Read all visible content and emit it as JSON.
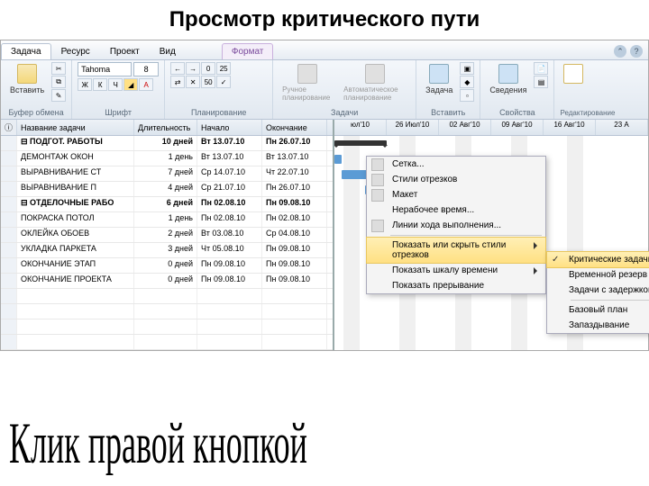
{
  "slide_title": "Просмотр критического пути",
  "caption": "Клик правой кнопкой",
  "tabs": {
    "task": "Задача",
    "resource": "Ресурс",
    "project": "Проект",
    "view": "Вид",
    "format": "Формат"
  },
  "ribbon": {
    "clipboard": {
      "label": "Буфер обмена",
      "paste": "Вставить"
    },
    "font": {
      "label": "Шрифт",
      "family": "Tahoma",
      "size": "8",
      "bold": "Ж",
      "italic": "К",
      "underline": "Ч"
    },
    "schedule": {
      "label": "Планирование"
    },
    "tasks": {
      "label": "Задачи",
      "manual": "Ручное планирование",
      "auto": "Автоматическое планирование"
    },
    "insert": {
      "label": "Вставить",
      "task": "Задача"
    },
    "props": {
      "label": "Свойства",
      "info": "Сведения"
    },
    "edit": {
      "label": "Редактирование"
    }
  },
  "grid": {
    "headers": {
      "name": "Название задачи",
      "dur": "Длительность",
      "start": "Начало",
      "end": "Окончание"
    },
    "rows": [
      {
        "id": "1",
        "name": "⊟ ПОДГОТ. РАБОТЫ",
        "dur": "10 дней",
        "s": "Вт 13.07.10",
        "e": "Пн 26.07.10",
        "bold": true
      },
      {
        "id": "2",
        "name": "ДЕМОНТАЖ ОКОН",
        "dur": "1 день",
        "s": "Вт 13.07.10",
        "e": "Вт 13.07.10"
      },
      {
        "id": "3",
        "name": "ВЫРАВНИВАНИЕ СТ",
        "dur": "7 дней",
        "s": "Ср 14.07.10",
        "e": "Чт 22.07.10"
      },
      {
        "id": "4",
        "name": "ВЫРАВНИВАНИЕ П",
        "dur": "4 дней",
        "s": "Ср 21.07.10",
        "e": "Пн 26.07.10"
      },
      {
        "id": "5",
        "name": "⊟ ОТДЕЛОЧНЫЕ РАБО",
        "dur": "6 дней",
        "s": "Пн 02.08.10",
        "e": "Пн 09.08.10",
        "bold": true
      },
      {
        "id": "6",
        "name": "ПОКРАСКА ПОТОЛ",
        "dur": "1 день",
        "s": "Пн 02.08.10",
        "e": "Пн 02.08.10"
      },
      {
        "id": "7",
        "name": "ОКЛЕЙКА ОБОЕВ",
        "dur": "2 дней",
        "s": "Вт 03.08.10",
        "e": "Ср 04.08.10"
      },
      {
        "id": "8",
        "name": "УКЛАДКА ПАРКЕТА",
        "dur": "3 дней",
        "s": "Чт 05.08.10",
        "e": "Пн 09.08.10"
      },
      {
        "id": "9",
        "name": "ОКОНЧАНИЕ ЭТАП",
        "dur": "0 дней",
        "s": "Пн 09.08.10",
        "e": "Пн 09.08.10"
      },
      {
        "id": "10",
        "name": "ОКОНЧАНИЕ ПРОЕКТА",
        "dur": "0 дней",
        "s": "Пн 09.08.10",
        "e": "Пн 09.08.10"
      }
    ]
  },
  "timeline": {
    "cols": [
      "юл'10",
      "26 Июл'10",
      "02 Авг'10",
      "09 Авг'10",
      "16 Авг'10",
      "23 А"
    ]
  },
  "ctx": {
    "grid": "Сетка...",
    "styles": "Стили отрезков",
    "layout": "Макет",
    "nonwork": "Нерабочее время...",
    "progress": "Линии хода выполнения...",
    "toggle": "Показать или скрыть стили отрезков",
    "timescale": "Показать шкалу времени",
    "split": "Показать прерывание"
  },
  "submenu": {
    "crit": "Критические задачи",
    "slack": "Временной резерв",
    "late": "Задачи с задержкой",
    "baseline": "Базовый план",
    "slip": "Запаздывание"
  }
}
